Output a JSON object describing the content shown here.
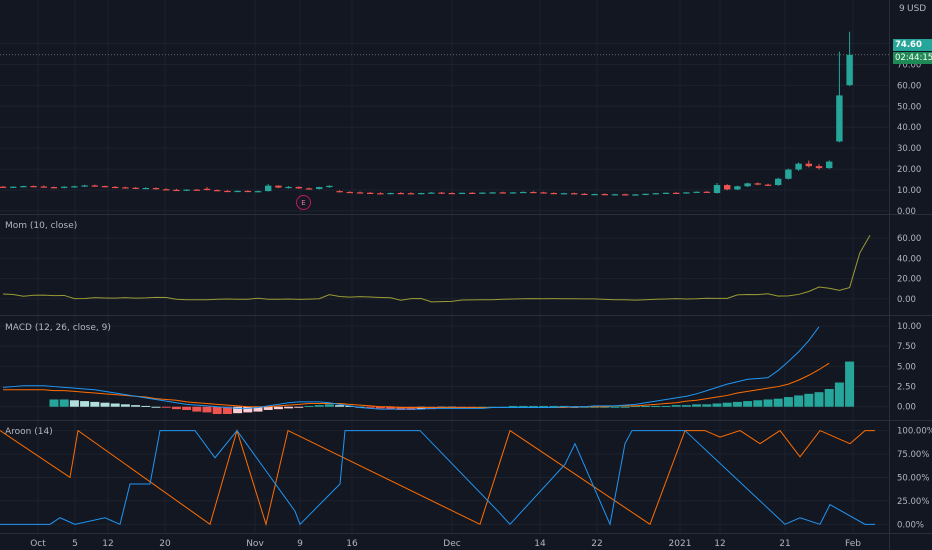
{
  "header": {
    "settings_number": "9",
    "currency": "USD"
  },
  "price_tags": {
    "last_price": "74.60",
    "countdown": "02:44:15"
  },
  "earnings_marker": "E",
  "colors": {
    "background": "#131722",
    "up": "#26a69a",
    "down": "#ef5350",
    "grid": "#1e222d",
    "text": "#b2b5be",
    "momentum": "#9b9b34",
    "macd": "#2196f3",
    "signal": "#ff6d00",
    "aroon_up": "#ff6d00",
    "aroon_down": "#2196f3"
  },
  "chart_data": [
    {
      "type": "candlestick",
      "title": "",
      "x_tick_labels": [
        "Oct",
        "5",
        "12",
        "20",
        "Nov",
        "9",
        "16",
        "Dec",
        "14",
        "22",
        "2021",
        "12",
        "21",
        "Feb"
      ],
      "y_ticks": [
        "0.00",
        "10.00",
        "20.00",
        "30.00",
        "40.00",
        "50.00",
        "60.00",
        "70.00",
        "80.00"
      ],
      "ylim": [
        0,
        85
      ],
      "candles": [
        [
          11.6,
          11.9,
          11.1,
          11.4
        ],
        [
          11.4,
          11.8,
          11.0,
          11.6
        ],
        [
          11.6,
          12.0,
          11.3,
          11.9
        ],
        [
          11.9,
          12.2,
          11.4,
          11.7
        ],
        [
          11.7,
          12.2,
          11.2,
          11.4
        ],
        [
          11.4,
          11.7,
          10.9,
          11.1
        ],
        [
          11.1,
          11.8,
          10.8,
          11.6
        ],
        [
          11.6,
          12.1,
          11.1,
          11.8
        ],
        [
          11.8,
          12.5,
          11.5,
          12.2
        ],
        [
          12.2,
          12.6,
          11.6,
          11.9
        ],
        [
          11.9,
          12.1,
          11.3,
          11.5
        ],
        [
          11.5,
          11.9,
          11.0,
          11.3
        ],
        [
          11.3,
          11.6,
          10.8,
          11.1
        ],
        [
          11.1,
          11.4,
          10.6,
          10.8
        ],
        [
          10.8,
          11.3,
          10.5,
          11.0
        ],
        [
          11.0,
          11.2,
          10.2,
          10.4
        ],
        [
          10.4,
          10.8,
          9.9,
          10.1
        ],
        [
          10.1,
          10.6,
          9.7,
          9.9
        ],
        [
          9.9,
          10.4,
          9.6,
          10.2
        ],
        [
          10.2,
          10.5,
          9.8,
          10.0
        ],
        [
          10.6,
          11.4,
          9.9,
          10.0
        ],
        [
          10.0,
          10.3,
          9.4,
          9.6
        ],
        [
          9.6,
          10.0,
          9.2,
          9.4
        ],
        [
          9.4,
          9.8,
          9.0,
          9.6
        ],
        [
          9.6,
          9.9,
          9.1,
          9.3
        ],
        [
          9.3,
          9.7,
          8.9,
          9.5
        ],
        [
          9.5,
          12.9,
          9.3,
          12.1
        ],
        [
          12.1,
          12.3,
          10.9,
          11.2
        ],
        [
          11.2,
          11.9,
          10.7,
          11.5
        ],
        [
          11.5,
          11.7,
          10.6,
          10.8
        ],
        [
          10.8,
          11.2,
          10.3,
          10.5
        ],
        [
          10.5,
          11.6,
          10.3,
          11.4
        ],
        [
          11.4,
          12.3,
          11.1,
          12.0
        ],
        [
          9.5,
          9.9,
          8.9,
          9.1
        ],
        [
          9.1,
          9.4,
          8.7,
          8.9
        ],
        [
          8.9,
          9.3,
          8.5,
          8.7
        ],
        [
          8.7,
          9.1,
          8.3,
          8.5
        ],
        [
          8.5,
          8.9,
          8.1,
          8.4
        ],
        [
          8.4,
          8.8,
          8.0,
          8.6
        ],
        [
          8.6,
          9.0,
          8.2,
          8.5
        ],
        [
          8.5,
          8.9,
          8.1,
          8.3
        ],
        [
          8.3,
          8.7,
          7.9,
          8.6
        ],
        [
          8.6,
          9.0,
          8.3,
          8.8
        ],
        [
          8.8,
          9.1,
          8.4,
          8.6
        ],
        [
          8.6,
          8.9,
          8.2,
          8.4
        ],
        [
          8.4,
          8.8,
          8.1,
          8.7
        ],
        [
          8.7,
          9.0,
          8.3,
          8.5
        ],
        [
          8.5,
          8.9,
          8.2,
          8.8
        ],
        [
          8.8,
          9.1,
          8.4,
          8.9
        ],
        [
          8.9,
          9.2,
          8.5,
          8.7
        ],
        [
          8.7,
          9.0,
          8.3,
          8.9
        ],
        [
          8.9,
          9.3,
          8.6,
          9.1
        ],
        [
          9.1,
          9.4,
          8.7,
          8.9
        ],
        [
          8.9,
          9.2,
          8.5,
          8.6
        ],
        [
          8.6,
          8.9,
          8.2,
          8.3
        ],
        [
          8.3,
          8.7,
          8.0,
          8.5
        ],
        [
          8.5,
          8.8,
          8.1,
          8.2
        ],
        [
          8.2,
          8.5,
          7.8,
          7.9
        ],
        [
          7.9,
          8.3,
          7.6,
          8.1
        ],
        [
          8.1,
          8.4,
          7.7,
          7.8
        ],
        [
          7.8,
          8.2,
          7.5,
          8.0
        ],
        [
          8.0,
          8.3,
          7.6,
          7.7
        ],
        [
          7.7,
          8.1,
          7.4,
          7.9
        ],
        [
          7.9,
          8.3,
          7.6,
          8.2
        ],
        [
          8.2,
          8.6,
          7.9,
          8.5
        ],
        [
          8.5,
          8.9,
          8.2,
          8.7
        ],
        [
          8.7,
          9.0,
          8.3,
          8.6
        ],
        [
          8.6,
          9.0,
          8.3,
          8.9
        ],
        [
          8.9,
          9.3,
          8.6,
          9.2
        ],
        [
          9.2,
          9.5,
          8.8,
          9.1
        ],
        [
          8.6,
          13.4,
          8.3,
          12.4
        ],
        [
          12.4,
          12.8,
          9.9,
          10.3
        ],
        [
          10.3,
          12.1,
          10.0,
          11.8
        ],
        [
          11.8,
          13.5,
          11.5,
          13.2
        ],
        [
          13.2,
          13.6,
          12.3,
          12.6
        ],
        [
          12.6,
          13.0,
          11.9,
          12.4
        ],
        [
          12.4,
          15.9,
          12.0,
          15.4
        ],
        [
          15.4,
          20.2,
          15.0,
          19.8
        ],
        [
          19.8,
          23.2,
          19.1,
          22.6
        ],
        [
          22.6,
          24.1,
          20.8,
          21.4
        ],
        [
          21.4,
          22.3,
          19.8,
          20.5
        ],
        [
          20.5,
          24.2,
          20.1,
          23.6
        ],
        [
          33.2,
          76.1,
          32.8,
          55.2
        ],
        [
          60.1,
          85.6,
          59.6,
          74.6
        ]
      ]
    },
    {
      "type": "line",
      "title": "Mom (10, close)",
      "y_ticks": [
        "0.00",
        "20.00",
        "40.00",
        "60.00"
      ],
      "ylim": [
        -8,
        70
      ],
      "series": [
        {
          "values": [
            4.8,
            4.3,
            2.6,
            3.6,
            3.7,
            3.2,
            3.4,
            0.3,
            0.4,
            1.2,
            0.9,
            0.8,
            1.2,
            0.8,
            1.0,
            1.5,
            1.4,
            -0.3,
            -0.8,
            -0.9,
            -0.9,
            -0.3,
            -0.1,
            -0.3,
            -0.3,
            0.6,
            -0.3,
            -0.4,
            -0.1,
            -0.5,
            -0.2,
            0.2,
            4.2,
            2.4,
            1.8,
            2.2,
            1.9,
            1.4,
            1.1,
            -1.3,
            0.3,
            0.4,
            -2.9,
            -2.7,
            -2.4,
            -1.1,
            -1.0,
            -0.9,
            -0.8,
            -0.3,
            -0.1,
            0.1,
            0.3,
            0.2,
            0.3,
            0.2,
            0.1,
            0.0,
            0.0,
            -0.5,
            -0.8,
            -0.8,
            -1.2,
            -0.8,
            -0.3,
            -0.1,
            0.3,
            -0.1,
            0.1,
            0.6,
            0.5,
            0.5,
            4.0,
            4.4,
            4.2,
            5.1,
            2.8,
            3.0,
            4.4,
            7.3,
            11.7,
            10.5,
            8.4,
            11.2,
            45.4,
            62.8
          ]
        }
      ]
    },
    {
      "type": "line+bar",
      "title": "MACD (12, 26, close, 9)",
      "y_ticks": [
        "0.00",
        "2.50",
        "5.00",
        "7.50",
        "10.00"
      ],
      "ylim": [
        -0.9,
        10.5
      ],
      "macd": [
        2.4,
        2.5,
        2.6,
        2.6,
        2.6,
        2.5,
        2.4,
        2.3,
        2.2,
        2.1,
        1.9,
        1.7,
        1.5,
        1.3,
        1.1,
        0.9,
        0.7,
        0.5,
        0.3,
        0.2,
        0.1,
        0.0,
        -0.1,
        -0.2,
        -0.2,
        -0.1,
        0.1,
        0.3,
        0.5,
        0.6,
        0.6,
        0.6,
        0.5,
        0.3,
        0.1,
        -0.1,
        -0.2,
        -0.3,
        -0.3,
        -0.3,
        -0.3,
        -0.3,
        -0.2,
        -0.2,
        -0.2,
        -0.2,
        -0.2,
        -0.2,
        -0.1,
        -0.1,
        -0.1,
        -0.1,
        -0.1,
        -0.1,
        -0.1,
        0.0,
        0.0,
        0.0,
        0.1,
        0.1,
        0.1,
        0.2,
        0.3,
        0.5,
        0.7,
        0.9,
        1.1,
        1.3,
        1.6,
        2.0,
        2.4,
        2.8,
        3.1,
        3.4,
        3.5,
        3.6,
        4.5,
        5.6,
        6.8,
        8.2,
        9.9
      ],
      "signal": [
        2.1,
        2.1,
        2.1,
        2.1,
        2.1,
        2.0,
        2.0,
        1.9,
        1.8,
        1.7,
        1.6,
        1.5,
        1.4,
        1.3,
        1.2,
        1.0,
        0.9,
        0.8,
        0.6,
        0.5,
        0.4,
        0.3,
        0.2,
        0.1,
        0.0,
        0.0,
        0.0,
        0.1,
        0.2,
        0.3,
        0.4,
        0.4,
        0.4,
        0.4,
        0.3,
        0.2,
        0.1,
        0.0,
        0.0,
        -0.1,
        -0.1,
        -0.1,
        -0.1,
        -0.1,
        -0.1,
        -0.1,
        -0.1,
        -0.1,
        -0.1,
        -0.1,
        -0.1,
        -0.1,
        -0.1,
        -0.1,
        -0.1,
        -0.1,
        0.0,
        0.0,
        0.0,
        0.0,
        0.1,
        0.1,
        0.1,
        0.2,
        0.3,
        0.4,
        0.5,
        0.7,
        0.8,
        1.0,
        1.2,
        1.4,
        1.7,
        1.9,
        2.1,
        2.3,
        2.5,
        2.8,
        3.3,
        3.9,
        4.6,
        5.4
      ],
      "histogram": [
        0.9,
        0.9,
        0.8,
        0.7,
        0.6,
        0.5,
        0.4,
        0.3,
        0.2,
        0.1,
        0.0,
        -0.1,
        -0.3,
        -0.4,
        -0.6,
        -0.7,
        -0.9,
        -0.9,
        -0.8,
        -0.7,
        -0.6,
        -0.4,
        -0.3,
        -0.2,
        -0.1,
        0.1,
        0.2,
        0.3,
        0.2,
        0.1,
        0.0,
        -0.1,
        -0.2,
        -0.3,
        -0.4,
        -0.4,
        -0.3,
        -0.3,
        -0.2,
        -0.1,
        -0.1,
        -0.1,
        0.0,
        0.0,
        0.0,
        0.1,
        0.1,
        0.1,
        0.1,
        0.1,
        0.1,
        0.0,
        0.0,
        0.0,
        0.0,
        0.0,
        0.0,
        0.1,
        0.1,
        0.1,
        0.1,
        0.2,
        0.2,
        0.3,
        0.3,
        0.4,
        0.5,
        0.6,
        0.7,
        0.8,
        0.9,
        1.0,
        1.2,
        1.4,
        1.6,
        1.8,
        2.2,
        3.0,
        5.6
      ]
    },
    {
      "type": "line",
      "title": "Aroon (14)",
      "y_ticks": [
        "0.00%",
        "25.00%",
        "50.00%",
        "75.00%",
        "100.00%"
      ],
      "ylim": [
        -5,
        107
      ],
      "series": [
        {
          "values": [
            [
              0,
              100
            ],
            [
              70,
              50
            ],
            [
              78,
              100
            ],
            [
              210,
              0
            ],
            [
              237,
              100
            ],
            [
              266,
              0
            ],
            [
              288,
              100
            ],
            [
              480,
              0
            ],
            [
              510,
              100
            ],
            [
              650,
              0
            ],
            [
              685,
              100
            ],
            [
              705,
              100
            ],
            [
              720,
              93
            ],
            [
              740,
              100
            ],
            [
              760,
              86
            ],
            [
              780,
              100
            ],
            [
              800,
              72
            ],
            [
              820,
              100
            ],
            [
              850,
              86
            ],
            [
              865,
              100
            ],
            [
              875,
              100
            ]
          ]
        },
        {
          "values": [
            [
              0,
              0
            ],
            [
              50,
              0
            ],
            [
              60,
              7
            ],
            [
              75,
              0
            ],
            [
              105,
              7
            ],
            [
              120,
              0
            ],
            [
              130,
              43
            ],
            [
              150,
              43
            ],
            [
              160,
              100
            ],
            [
              195,
              100
            ],
            [
              215,
              71
            ],
            [
              237,
              100
            ],
            [
              295,
              14
            ],
            [
              300,
              0
            ],
            [
              340,
              43
            ],
            [
              345,
              100
            ],
            [
              420,
              100
            ],
            [
              498,
              14
            ],
            [
              510,
              0
            ],
            [
              565,
              64
            ],
            [
              575,
              86
            ],
            [
              610,
              0
            ],
            [
              625,
              86
            ],
            [
              632,
              100
            ],
            [
              685,
              100
            ],
            [
              785,
              0
            ],
            [
              800,
              7
            ],
            [
              820,
              0
            ],
            [
              830,
              21
            ],
            [
              865,
              0
            ],
            [
              875,
              0
            ]
          ]
        }
      ]
    }
  ]
}
